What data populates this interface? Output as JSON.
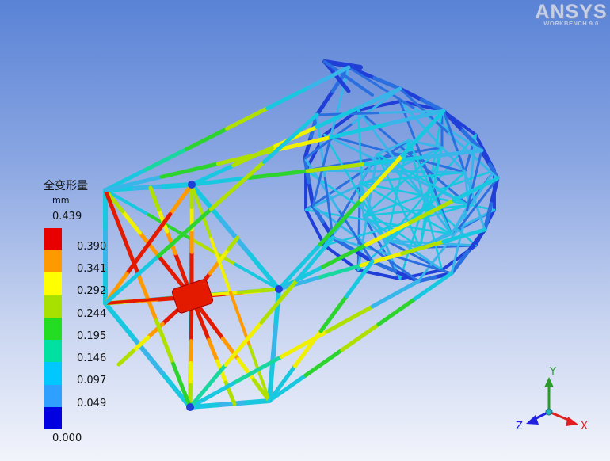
{
  "branding": {
    "product": "ANSYS",
    "subtitle": "WORKBENCH 9.0"
  },
  "legend": {
    "title": "全变形量",
    "unit": "mm",
    "max_label": "0.439",
    "min_label": "0.000",
    "ticks": [
      "0.390",
      "0.341",
      "0.292",
      "0.244",
      "0.195",
      "0.146",
      "0.097",
      "0.049"
    ],
    "colors": [
      "#e80000",
      "#ff9900",
      "#ffff00",
      "#a8e000",
      "#22dd22",
      "#00e0a0",
      "#00c8ff",
      "#2fa0ff",
      "#0000e0"
    ]
  },
  "triad": {
    "y_label": "Y",
    "x_label": "X",
    "z_label": "Z",
    "y_color": "#2c9b2c",
    "x_color": "#e02020",
    "z_color": "#2020e0",
    "origin_color": "#2ab0b8"
  },
  "model": {
    "name": "telescope truss structure",
    "result": "total deformation contour"
  }
}
